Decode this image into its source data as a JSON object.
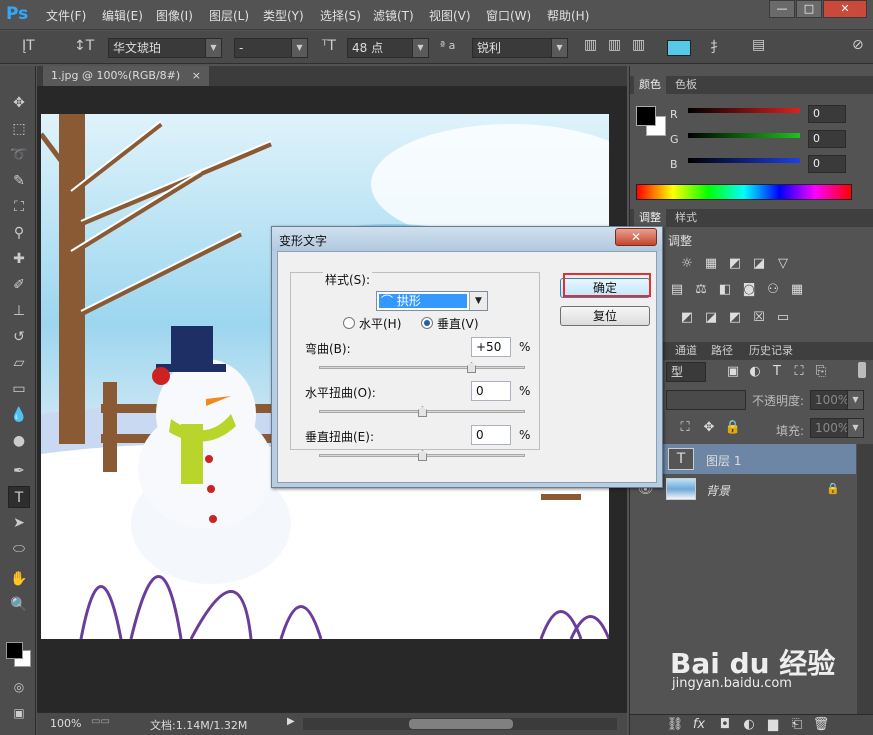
{
  "app": {
    "logo": "Ps"
  },
  "menu": [
    "文件(F)",
    "编辑(E)",
    "图像(I)",
    "图层(L)",
    "类型(Y)",
    "选择(S)",
    "滤镜(T)",
    "视图(V)",
    "窗口(W)",
    "帮助(H)"
  ],
  "window_controls": {
    "minimize": "—",
    "restore": "□",
    "close": "✕"
  },
  "options": {
    "font_family": "华文琥珀",
    "font_style": "-",
    "font_size": "48 点",
    "aa_label": "ª a",
    "antialias": "锐利",
    "color_swatch": "#56c8e8"
  },
  "document": {
    "tab_title": "1.jpg @ 100%(RGB/8#)",
    "tab_close": "×"
  },
  "status": {
    "zoom": "100%",
    "doc_info": "文档:1.14M/1.32M"
  },
  "color_panel": {
    "tabs": [
      "颜色",
      "色板"
    ],
    "rows": [
      {
        "label": "R",
        "value": "0",
        "color": "#e02020"
      },
      {
        "label": "G",
        "value": "0",
        "color": "#20c020"
      },
      {
        "label": "B",
        "value": "0",
        "color": "#2040e0"
      }
    ]
  },
  "adjust_panel": {
    "tabs": [
      "调整",
      "样式"
    ],
    "title": "调整"
  },
  "layers_panel": {
    "tabs": [
      "通道",
      "路径",
      "历史记录"
    ],
    "kind_label": "型",
    "opacity_label": "不透明度:",
    "opacity_value": "100%",
    "fill_label": "填充:",
    "fill_value": "100%",
    "layers": [
      {
        "name": "图层 1",
        "type_icon": "T",
        "locked": false
      },
      {
        "name": "背景",
        "type_icon": "",
        "locked": true
      }
    ]
  },
  "dialog": {
    "title": "变形文字",
    "close": "✕",
    "style_label": "样式(S):",
    "style_value": "拱形",
    "horizontal": "水平(H)",
    "vertical": "垂直(V)",
    "orientation": "vertical",
    "bend_label": "弯曲(B):",
    "bend_value": "+50",
    "h_distort_label": "水平扭曲(O):",
    "h_distort_value": "0",
    "v_distort_label": "垂直扭曲(E):",
    "v_distort_value": "0",
    "percent": "%",
    "ok": "确定",
    "reset": "复位"
  },
  "watermark": {
    "text": "Bai du 经验",
    "url": "jingyan.baidu.com"
  }
}
